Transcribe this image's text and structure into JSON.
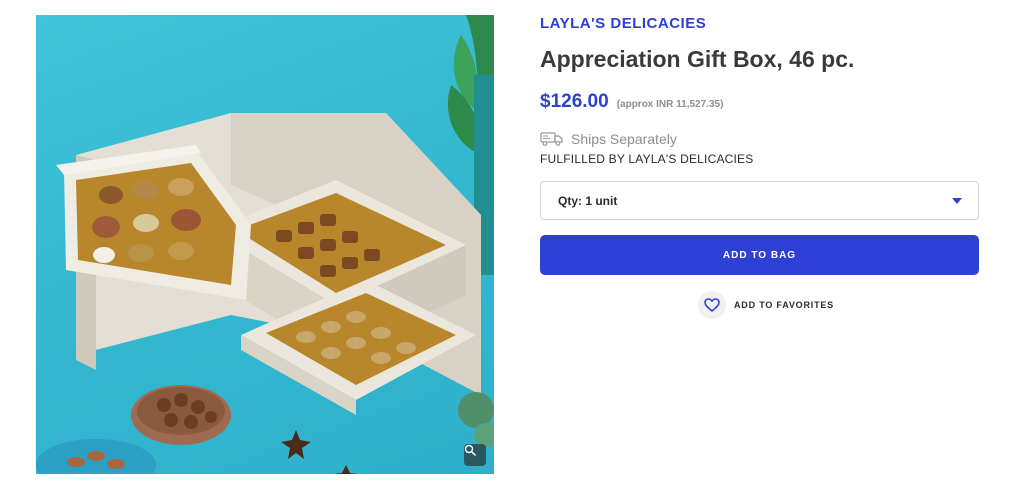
{
  "product": {
    "brand": "LAYLA'S DELICACIES",
    "title": "Appreciation Gift Box, 46 pc.",
    "price": "$126.00",
    "approx_price": "(approx INR 11,527.35)",
    "shipping_text": "Ships Separately",
    "fulfilled_by": "FULFILLED BY LAYLA'S DELICACIES",
    "image_alt": "Appreciation Gift Box"
  },
  "quantity": {
    "selected": "Qty: 1 unit"
  },
  "actions": {
    "add_to_bag_label": "ADD TO BAG",
    "add_to_favorites_label": "ADD TO FAVORITES"
  },
  "icons": {
    "truck": "truck-icon",
    "heart": "heart-icon",
    "zoom": "zoom-icon",
    "caret": "chevron-down-icon"
  },
  "colors": {
    "accent": "#2d3fd4",
    "muted_text": "#8d8d8d",
    "image_background": "#37bcd3"
  }
}
